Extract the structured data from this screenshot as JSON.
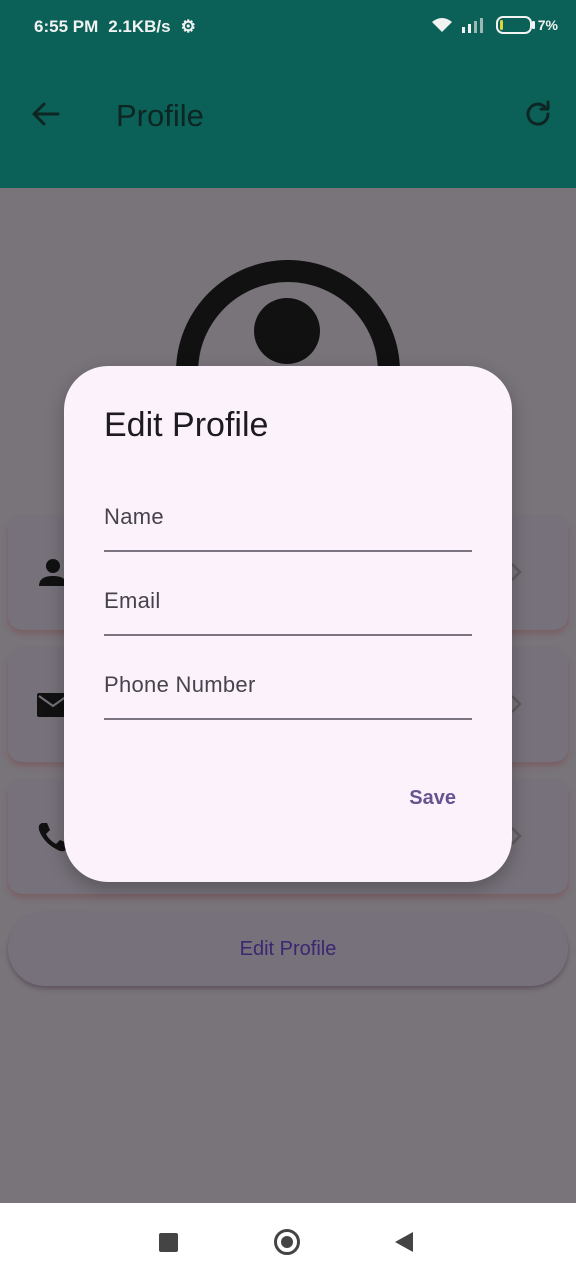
{
  "status_bar": {
    "time": "6:55 PM",
    "speed": "2.1KB/s",
    "battery": "7%"
  },
  "app_bar": {
    "title": "Profile",
    "back_icon": "arrow-left-icon",
    "refresh_icon": "refresh-icon"
  },
  "profile": {
    "cards": [
      {
        "icon": "person-icon"
      },
      {
        "icon": "mail-icon"
      },
      {
        "icon": "phone-icon"
      }
    ],
    "edit_button_label": "Edit Profile"
  },
  "dialog": {
    "title": "Edit Profile",
    "fields": [
      {
        "label": "Name",
        "value": ""
      },
      {
        "label": "Email",
        "value": ""
      },
      {
        "label": "Phone Number",
        "value": ""
      }
    ],
    "save_label": "Save"
  },
  "colors": {
    "app_bar": "#0b6158",
    "scrim": "#79747a",
    "dialog_bg": "#fcf2fc",
    "accent": "#65558f"
  }
}
